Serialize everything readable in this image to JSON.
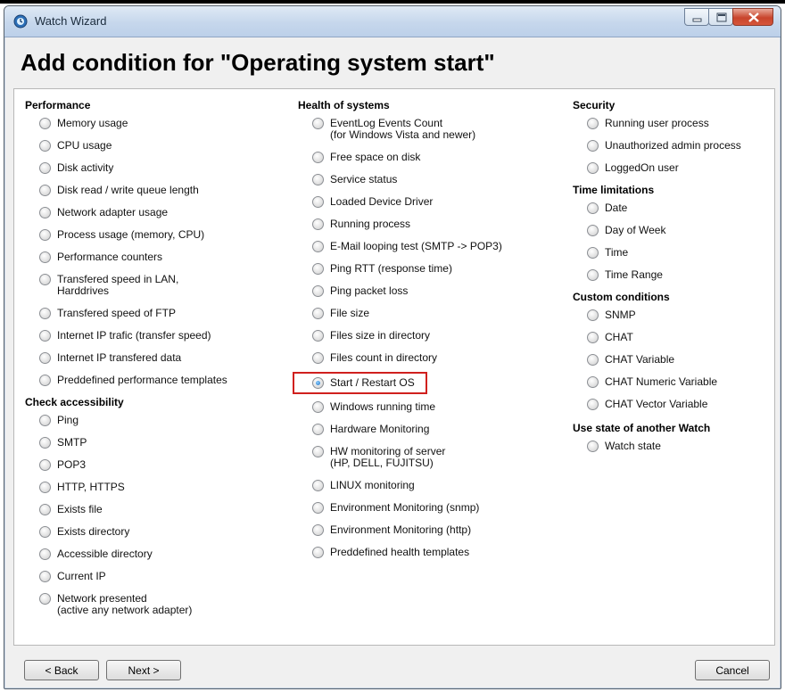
{
  "window": {
    "title": "Watch Wizard",
    "icon": "watch-wizard-app-icon"
  },
  "heading": "Add condition for \"Operating system start\"",
  "columns": [
    {
      "sections": [
        {
          "title": "Performance",
          "items": [
            {
              "label": "Memory usage",
              "checked": false
            },
            {
              "label": "CPU usage",
              "checked": false
            },
            {
              "label": "Disk activity",
              "checked": false
            },
            {
              "label": "Disk read / write queue length",
              "checked": false
            },
            {
              "label": "Network adapter usage",
              "checked": false
            },
            {
              "label": "Process usage (memory, CPU)",
              "checked": false
            },
            {
              "label": "Performance counters",
              "checked": false
            },
            {
              "label": "Transfered speed in LAN,\nHarddrives",
              "checked": false
            },
            {
              "label": "Transfered speed of FTP",
              "checked": false
            },
            {
              "label": "Internet IP trafic (transfer speed)",
              "checked": false
            },
            {
              "label": "Internet IP transfered data",
              "checked": false
            },
            {
              "label": "Preddefined performance templates",
              "checked": false
            }
          ]
        },
        {
          "title": "Check accessibility",
          "items": [
            {
              "label": "Ping",
              "checked": false
            },
            {
              "label": "SMTP",
              "checked": false
            },
            {
              "label": "POP3",
              "checked": false
            },
            {
              "label": "HTTP, HTTPS",
              "checked": false
            },
            {
              "label": "Exists file",
              "checked": false
            },
            {
              "label": "Exists directory",
              "checked": false
            },
            {
              "label": "Accessible directory",
              "checked": false
            },
            {
              "label": "Current IP",
              "checked": false
            },
            {
              "label": "Network presented\n(active any network adapter)",
              "checked": false
            }
          ]
        }
      ]
    },
    {
      "sections": [
        {
          "title": "Health of systems",
          "items": [
            {
              "label": "EventLog Events Count\n(for Windows Vista and newer)",
              "checked": false
            },
            {
              "label": "Free space on disk",
              "checked": false
            },
            {
              "label": "Service status",
              "checked": false
            },
            {
              "label": "Loaded Device Driver",
              "checked": false
            },
            {
              "label": "Running process",
              "checked": false
            },
            {
              "label": "E-Mail looping test (SMTP -> POP3)",
              "checked": false
            },
            {
              "label": "Ping RTT (response time)",
              "checked": false
            },
            {
              "label": "Ping packet loss",
              "checked": false
            },
            {
              "label": "File size",
              "checked": false
            },
            {
              "label": "Files size in directory",
              "checked": false
            },
            {
              "label": "Files count in directory",
              "checked": false
            },
            {
              "label": "Start / Restart OS",
              "checked": true
            },
            {
              "label": "Windows running time",
              "checked": false
            },
            {
              "label": "Hardware Monitoring",
              "checked": false
            },
            {
              "label": "HW monitoring of server\n(HP, DELL, FUJITSU)",
              "checked": false
            },
            {
              "label": "LINUX monitoring",
              "checked": false
            },
            {
              "label": "Environment Monitoring (snmp)",
              "checked": false
            },
            {
              "label": "Environment Monitoring (http)",
              "checked": false
            },
            {
              "label": "Preddefined health templates",
              "checked": false
            }
          ]
        }
      ]
    },
    {
      "sections": [
        {
          "title": "Security",
          "items": [
            {
              "label": "Running user process",
              "checked": false
            },
            {
              "label": "Unauthorized admin process",
              "checked": false
            },
            {
              "label": "LoggedOn user",
              "checked": false
            }
          ]
        },
        {
          "title": "Time limitations",
          "items": [
            {
              "label": "Date",
              "checked": false
            },
            {
              "label": "Day of Week",
              "checked": false
            },
            {
              "label": "Time",
              "checked": false
            },
            {
              "label": "Time Range",
              "checked": false
            }
          ]
        },
        {
          "title": "Custom conditions",
          "items": [
            {
              "label": "SNMP",
              "checked": false
            },
            {
              "label": "CHAT",
              "checked": false
            },
            {
              "label": "CHAT Variable",
              "checked": false
            },
            {
              "label": "CHAT Numeric Variable",
              "checked": false
            },
            {
              "label": "CHAT Vector Variable",
              "checked": false
            }
          ]
        },
        {
          "title": "Use state of another Watch",
          "items": [
            {
              "label": "Watch state",
              "checked": false
            }
          ]
        }
      ]
    }
  ],
  "buttons": {
    "back": "< Back",
    "next": "Next >",
    "cancel": "Cancel"
  },
  "colors": {
    "highlight": "#d0201e",
    "radio_selected": "#1d6fc4",
    "title_bar": "#c6d7ec",
    "close_button": "#c8452c"
  }
}
